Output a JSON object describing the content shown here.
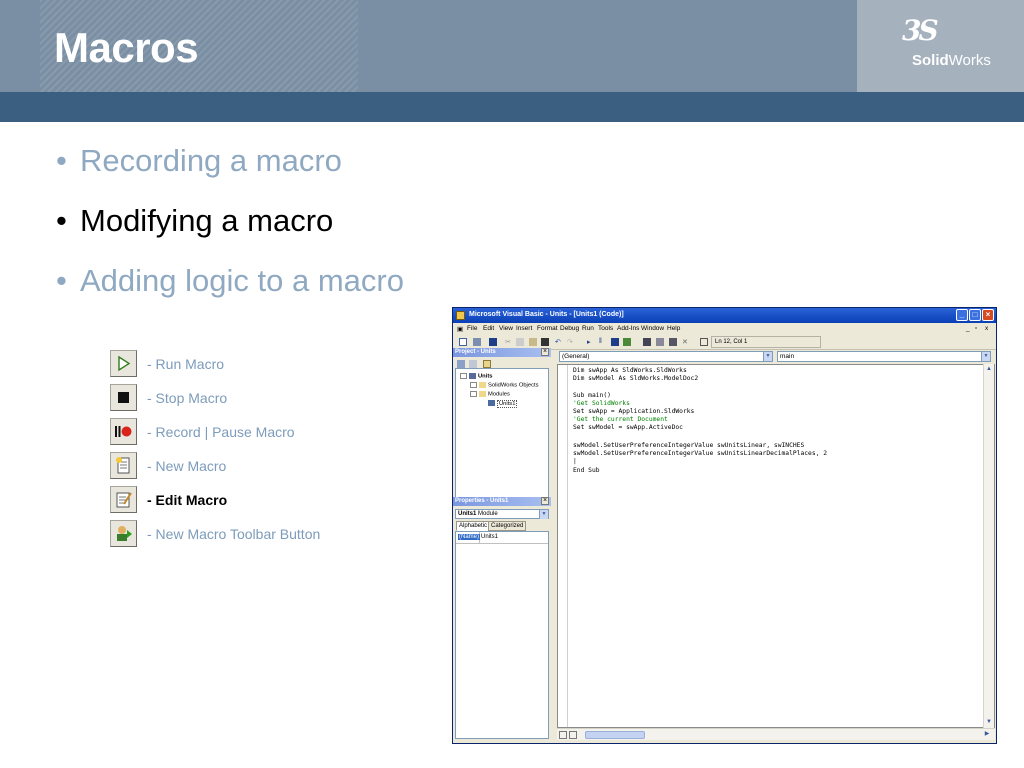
{
  "slide": {
    "title": "Macros",
    "logo": {
      "mark": "3S",
      "brand_bold": "Solid",
      "brand_regular": "Works"
    }
  },
  "bullets": [
    {
      "text": "Recording a macro",
      "active": false
    },
    {
      "text": "Modifying a macro",
      "active": true
    },
    {
      "text": "Adding logic to a macro",
      "active": false
    }
  ],
  "macro_tools": [
    {
      "icon": "run-macro-icon",
      "label": "- Run Macro",
      "active": false
    },
    {
      "icon": "stop-macro-icon",
      "label": "- Stop Macro",
      "active": false
    },
    {
      "icon": "record-pause-macro-icon",
      "label": "- Record | Pause Macro",
      "active": false
    },
    {
      "icon": "new-macro-icon",
      "label": "- New Macro",
      "active": false
    },
    {
      "icon": "edit-macro-icon",
      "label": "- Edit Macro",
      "active": true
    },
    {
      "icon": "new-macro-toolbar-button-icon",
      "label": "- New Macro Toolbar Button",
      "active": false
    }
  ],
  "vb_window": {
    "title": "Microsoft Visual Basic - Units - [Units1 (Code)]",
    "menu": [
      "File",
      "Edit",
      "View",
      "Insert",
      "Format",
      "Debug",
      "Run",
      "Tools",
      "Add-Ins",
      "Window",
      "Help"
    ],
    "cursor_position": "Ln 12, Col 1",
    "project_pane": {
      "title": "Project - Units",
      "tree": [
        "Units",
        "SolidWorks Objects",
        "Modules",
        "Units1"
      ]
    },
    "properties_pane": {
      "title": "Properties - Units1",
      "object_name": "Units1",
      "object_type": "Module",
      "tabs": [
        "Alphabetic",
        "Categorized"
      ],
      "property_name": "(Name)",
      "property_value": "Units1"
    },
    "object_combo": "(General)",
    "procedure_combo": "main",
    "code_lines": [
      "Dim swApp As SldWorks.SldWorks",
      "Dim swModel As SldWorks.ModelDoc2",
      "",
      "Sub main()",
      "'Get SolidWorks",
      "Set swApp = Application.SldWorks",
      "'Get the current Document",
      "Set swModel = swApp.ActiveDoc",
      "",
      "swModel.SetUserPreferenceIntegerValue swUnitsLinear, swINCHES",
      "swModel.SetUserPreferenceIntegerValue swUnitsLinearDecimalPlaces, 2",
      "|",
      "End Sub"
    ]
  },
  "colors": {
    "header": "#7a8fa3",
    "header_band": "#3b5f81",
    "bullet_inactive": "#8fa9c2",
    "tool_label_inactive": "#7d9bbb",
    "code_comment": "#008000"
  }
}
